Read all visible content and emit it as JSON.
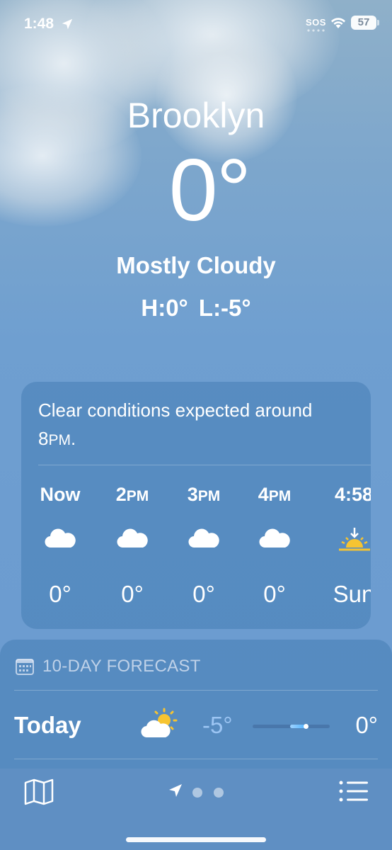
{
  "status_bar": {
    "time": "1:48",
    "carrier": "SOS",
    "battery": "57"
  },
  "location": {
    "city": "Brooklyn",
    "temperature": "0°",
    "condition": "Mostly Cloudy",
    "high_low": "H:0°  L:-5°"
  },
  "hourly": {
    "summary_text": "Clear conditions expected around 8",
    "summary_pm": "PM",
    "summary_end": ".",
    "hours": [
      {
        "time": "Now",
        "suffix": "",
        "icon": "cloud-icon",
        "temp": "0°"
      },
      {
        "time": "2",
        "suffix": "PM",
        "icon": "cloud-icon",
        "temp": "0°"
      },
      {
        "time": "3",
        "suffix": "PM",
        "icon": "cloud-icon",
        "temp": "0°"
      },
      {
        "time": "4",
        "suffix": "PM",
        "icon": "cloud-icon",
        "temp": "0°"
      },
      {
        "time": "4:58",
        "suffix": "",
        "icon": "sunset-icon",
        "temp": "Sun"
      }
    ]
  },
  "ten_day": {
    "title": "10-DAY FORECAST",
    "days": [
      {
        "day": "Today",
        "icon": "partly-cloudy-icon",
        "low": "-5°",
        "high": "0°",
        "range_start": 0.49,
        "range_end": 0.71,
        "current": 0.69
      }
    ]
  },
  "toolbar": {
    "map_icon": "map-icon",
    "location_icon": "location-arrow-icon",
    "list_icon": "list-icon",
    "pages": 3
  },
  "colors": {
    "sky": "#6d9dd0",
    "card": "#467db4",
    "low_temp": "#a0c8f5",
    "range_fill": "#4ab0ff"
  }
}
